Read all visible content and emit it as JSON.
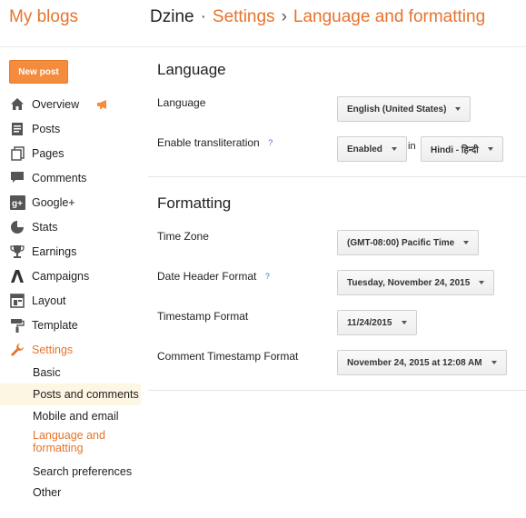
{
  "header": {
    "brand": "My blogs",
    "blog_name": "Dzine",
    "sep1": "·",
    "crumb1": "Settings",
    "sep2": "›",
    "crumb2": "Language and formatting"
  },
  "sidebar": {
    "new_post_label": "New post",
    "items": [
      {
        "label": "Overview",
        "icon": "home-icon"
      },
      {
        "label": "Posts",
        "icon": "posts-icon"
      },
      {
        "label": "Pages",
        "icon": "pages-icon"
      },
      {
        "label": "Comments",
        "icon": "comments-icon"
      },
      {
        "label": "Google+",
        "icon": "google-plus-icon"
      },
      {
        "label": "Stats",
        "icon": "stats-icon"
      },
      {
        "label": "Earnings",
        "icon": "trophy-icon"
      },
      {
        "label": "Campaigns",
        "icon": "campaigns-icon"
      },
      {
        "label": "Layout",
        "icon": "layout-icon"
      },
      {
        "label": "Template",
        "icon": "paint-roller-icon"
      },
      {
        "label": "Settings",
        "icon": "wrench-icon"
      }
    ],
    "settings_sub": {
      "basic": "Basic",
      "posts_comments": "Posts and comments",
      "mobile_email": "Mobile and email",
      "language_formatting": "Language and formatting",
      "search_prefs": "Search preferences",
      "other": "Other"
    },
    "accent": "#e8732c",
    "highlight": "#fdf6e3"
  },
  "language": {
    "title": "Language",
    "language_label": "Language",
    "language_value": "English (United States)",
    "translit_label": "Enable transliteration",
    "help_glyph": "?",
    "translit_value": "Enabled",
    "in_text": "in",
    "translit_lang": "Hindi - हिन्दी"
  },
  "formatting": {
    "title": "Formatting",
    "tz_label": "Time Zone",
    "tz_value": "(GMT-08:00) Pacific Time",
    "date_header_label": "Date Header Format",
    "date_header_value": "Tuesday, November 24, 2015",
    "timestamp_label": "Timestamp Format",
    "timestamp_value": "11/24/2015",
    "comment_ts_label": "Comment Timestamp Format",
    "comment_ts_value": "November 24, 2015 at 12:08 AM"
  }
}
